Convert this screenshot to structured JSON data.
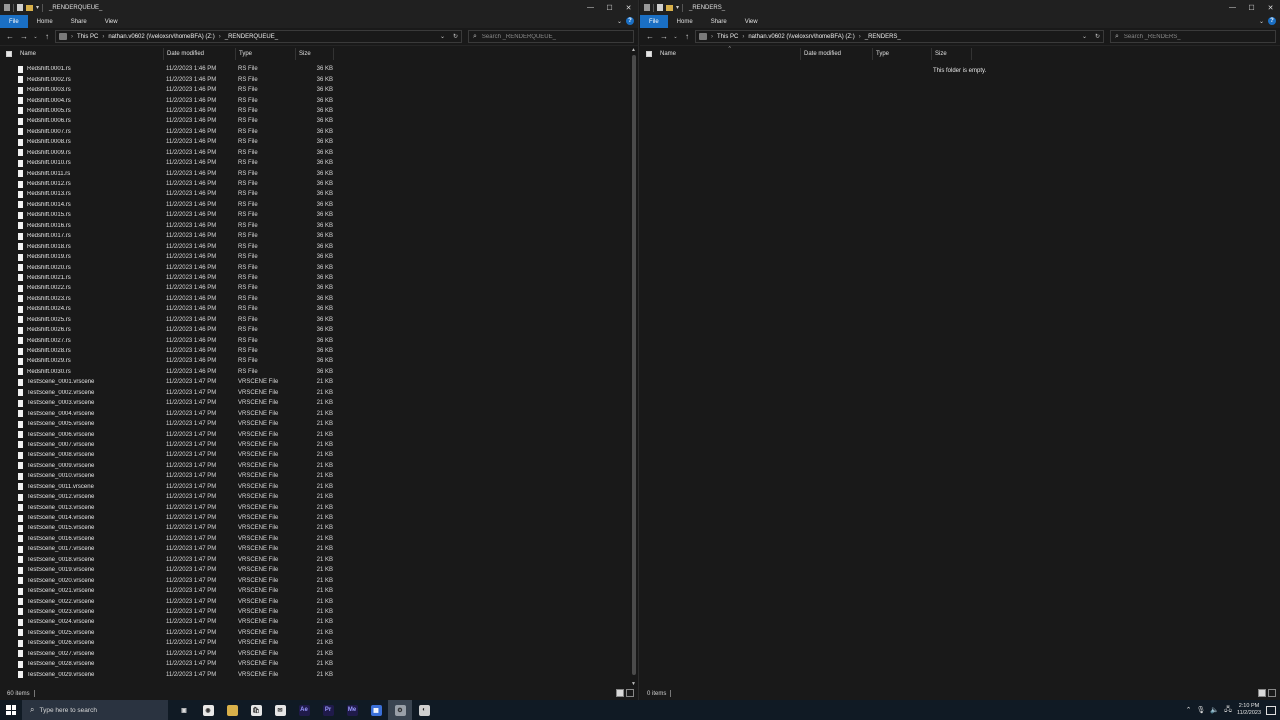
{
  "left": {
    "title": "_RENDERQUEUE_",
    "ribbon_tabs": [
      "File",
      "Home",
      "Share",
      "View"
    ],
    "breadcrumb": [
      "This PC",
      "nathan.v0602 (\\\\veloxsrv\\homeBFA) (Z:)",
      "_RENDERQUEUE_"
    ],
    "search_placeholder": "Search _RENDERQUEUE_",
    "columns": {
      "name": "Name",
      "date": "Date modified",
      "type": "Type",
      "size": "Size"
    },
    "files": [
      {
        "name": "Redshift.0001.rs",
        "date": "11/2/2023 1:46 PM",
        "type": "RS File",
        "size": "36 KB"
      },
      {
        "name": "Redshift.0002.rs",
        "date": "11/2/2023 1:46 PM",
        "type": "RS File",
        "size": "36 KB"
      },
      {
        "name": "Redshift.0003.rs",
        "date": "11/2/2023 1:46 PM",
        "type": "RS File",
        "size": "36 KB"
      },
      {
        "name": "Redshift.0004.rs",
        "date": "11/2/2023 1:46 PM",
        "type": "RS File",
        "size": "36 KB"
      },
      {
        "name": "Redshift.0005.rs",
        "date": "11/2/2023 1:46 PM",
        "type": "RS File",
        "size": "36 KB"
      },
      {
        "name": "Redshift.0006.rs",
        "date": "11/2/2023 1:46 PM",
        "type": "RS File",
        "size": "36 KB"
      },
      {
        "name": "Redshift.0007.rs",
        "date": "11/2/2023 1:46 PM",
        "type": "RS File",
        "size": "36 KB"
      },
      {
        "name": "Redshift.0008.rs",
        "date": "11/2/2023 1:46 PM",
        "type": "RS File",
        "size": "36 KB"
      },
      {
        "name": "Redshift.0009.rs",
        "date": "11/2/2023 1:46 PM",
        "type": "RS File",
        "size": "36 KB"
      },
      {
        "name": "Redshift.0010.rs",
        "date": "11/2/2023 1:46 PM",
        "type": "RS File",
        "size": "36 KB"
      },
      {
        "name": "Redshift.0011.rs",
        "date": "11/2/2023 1:46 PM",
        "type": "RS File",
        "size": "36 KB"
      },
      {
        "name": "Redshift.0012.rs",
        "date": "11/2/2023 1:46 PM",
        "type": "RS File",
        "size": "36 KB"
      },
      {
        "name": "Redshift.0013.rs",
        "date": "11/2/2023 1:46 PM",
        "type": "RS File",
        "size": "36 KB"
      },
      {
        "name": "Redshift.0014.rs",
        "date": "11/2/2023 1:46 PM",
        "type": "RS File",
        "size": "36 KB"
      },
      {
        "name": "Redshift.0015.rs",
        "date": "11/2/2023 1:46 PM",
        "type": "RS File",
        "size": "36 KB"
      },
      {
        "name": "Redshift.0016.rs",
        "date": "11/2/2023 1:46 PM",
        "type": "RS File",
        "size": "36 KB"
      },
      {
        "name": "Redshift.0017.rs",
        "date": "11/2/2023 1:46 PM",
        "type": "RS File",
        "size": "36 KB"
      },
      {
        "name": "Redshift.0018.rs",
        "date": "11/2/2023 1:46 PM",
        "type": "RS File",
        "size": "36 KB"
      },
      {
        "name": "Redshift.0019.rs",
        "date": "11/2/2023 1:46 PM",
        "type": "RS File",
        "size": "36 KB"
      },
      {
        "name": "Redshift.0020.rs",
        "date": "11/2/2023 1:46 PM",
        "type": "RS File",
        "size": "36 KB"
      },
      {
        "name": "Redshift.0021.rs",
        "date": "11/2/2023 1:46 PM",
        "type": "RS File",
        "size": "36 KB"
      },
      {
        "name": "Redshift.0022.rs",
        "date": "11/2/2023 1:46 PM",
        "type": "RS File",
        "size": "36 KB"
      },
      {
        "name": "Redshift.0023.rs",
        "date": "11/2/2023 1:46 PM",
        "type": "RS File",
        "size": "36 KB"
      },
      {
        "name": "Redshift.0024.rs",
        "date": "11/2/2023 1:46 PM",
        "type": "RS File",
        "size": "36 KB"
      },
      {
        "name": "Redshift.0025.rs",
        "date": "11/2/2023 1:46 PM",
        "type": "RS File",
        "size": "36 KB"
      },
      {
        "name": "Redshift.0026.rs",
        "date": "11/2/2023 1:46 PM",
        "type": "RS File",
        "size": "36 KB"
      },
      {
        "name": "Redshift.0027.rs",
        "date": "11/2/2023 1:46 PM",
        "type": "RS File",
        "size": "36 KB"
      },
      {
        "name": "Redshift.0028.rs",
        "date": "11/2/2023 1:46 PM",
        "type": "RS File",
        "size": "36 KB"
      },
      {
        "name": "Redshift.0029.rs",
        "date": "11/2/2023 1:46 PM",
        "type": "RS File",
        "size": "36 KB"
      },
      {
        "name": "Redshift.0030.rs",
        "date": "11/2/2023 1:46 PM",
        "type": "RS File",
        "size": "36 KB"
      },
      {
        "name": "TestScene_0001.vrscene",
        "date": "11/2/2023 1:47 PM",
        "type": "VRSCENE File",
        "size": "21 KB"
      },
      {
        "name": "TestScene_0002.vrscene",
        "date": "11/2/2023 1:47 PM",
        "type": "VRSCENE File",
        "size": "21 KB"
      },
      {
        "name": "TestScene_0003.vrscene",
        "date": "11/2/2023 1:47 PM",
        "type": "VRSCENE File",
        "size": "21 KB"
      },
      {
        "name": "TestScene_0004.vrscene",
        "date": "11/2/2023 1:47 PM",
        "type": "VRSCENE File",
        "size": "21 KB"
      },
      {
        "name": "TestScene_0005.vrscene",
        "date": "11/2/2023 1:47 PM",
        "type": "VRSCENE File",
        "size": "21 KB"
      },
      {
        "name": "TestScene_0006.vrscene",
        "date": "11/2/2023 1:47 PM",
        "type": "VRSCENE File",
        "size": "21 KB"
      },
      {
        "name": "TestScene_0007.vrscene",
        "date": "11/2/2023 1:47 PM",
        "type": "VRSCENE File",
        "size": "21 KB"
      },
      {
        "name": "TestScene_0008.vrscene",
        "date": "11/2/2023 1:47 PM",
        "type": "VRSCENE File",
        "size": "21 KB"
      },
      {
        "name": "TestScene_0009.vrscene",
        "date": "11/2/2023 1:47 PM",
        "type": "VRSCENE File",
        "size": "21 KB"
      },
      {
        "name": "TestScene_0010.vrscene",
        "date": "11/2/2023 1:47 PM",
        "type": "VRSCENE File",
        "size": "21 KB"
      },
      {
        "name": "TestScene_0011.vrscene",
        "date": "11/2/2023 1:47 PM",
        "type": "VRSCENE File",
        "size": "21 KB"
      },
      {
        "name": "TestScene_0012.vrscene",
        "date": "11/2/2023 1:47 PM",
        "type": "VRSCENE File",
        "size": "21 KB"
      },
      {
        "name": "TestScene_0013.vrscene",
        "date": "11/2/2023 1:47 PM",
        "type": "VRSCENE File",
        "size": "21 KB"
      },
      {
        "name": "TestScene_0014.vrscene",
        "date": "11/2/2023 1:47 PM",
        "type": "VRSCENE File",
        "size": "21 KB"
      },
      {
        "name": "TestScene_0015.vrscene",
        "date": "11/2/2023 1:47 PM",
        "type": "VRSCENE File",
        "size": "21 KB"
      },
      {
        "name": "TestScene_0016.vrscene",
        "date": "11/2/2023 1:47 PM",
        "type": "VRSCENE File",
        "size": "21 KB"
      },
      {
        "name": "TestScene_0017.vrscene",
        "date": "11/2/2023 1:47 PM",
        "type": "VRSCENE File",
        "size": "21 KB"
      },
      {
        "name": "TestScene_0018.vrscene",
        "date": "11/2/2023 1:47 PM",
        "type": "VRSCENE File",
        "size": "21 KB"
      },
      {
        "name": "TestScene_0019.vrscene",
        "date": "11/2/2023 1:47 PM",
        "type": "VRSCENE File",
        "size": "21 KB"
      },
      {
        "name": "TestScene_0020.vrscene",
        "date": "11/2/2023 1:47 PM",
        "type": "VRSCENE File",
        "size": "21 KB"
      },
      {
        "name": "TestScene_0021.vrscene",
        "date": "11/2/2023 1:47 PM",
        "type": "VRSCENE File",
        "size": "21 KB"
      },
      {
        "name": "TestScene_0022.vrscene",
        "date": "11/2/2023 1:47 PM",
        "type": "VRSCENE File",
        "size": "21 KB"
      },
      {
        "name": "TestScene_0023.vrscene",
        "date": "11/2/2023 1:47 PM",
        "type": "VRSCENE File",
        "size": "21 KB"
      },
      {
        "name": "TestScene_0024.vrscene",
        "date": "11/2/2023 1:47 PM",
        "type": "VRSCENE File",
        "size": "21 KB"
      },
      {
        "name": "TestScene_0025.vrscene",
        "date": "11/2/2023 1:47 PM",
        "type": "VRSCENE File",
        "size": "21 KB"
      },
      {
        "name": "TestScene_0026.vrscene",
        "date": "11/2/2023 1:47 PM",
        "type": "VRSCENE File",
        "size": "21 KB"
      },
      {
        "name": "TestScene_0027.vrscene",
        "date": "11/2/2023 1:47 PM",
        "type": "VRSCENE File",
        "size": "21 KB"
      },
      {
        "name": "TestScene_0028.vrscene",
        "date": "11/2/2023 1:47 PM",
        "type": "VRSCENE File",
        "size": "21 KB"
      },
      {
        "name": "TestScene_0029.vrscene",
        "date": "11/2/2023 1:47 PM",
        "type": "VRSCENE File",
        "size": "21 KB"
      }
    ],
    "status": "60 items"
  },
  "right": {
    "title": "_RENDERS_",
    "ribbon_tabs": [
      "File",
      "Home",
      "Share",
      "View"
    ],
    "breadcrumb": [
      "This PC",
      "nathan.v0602 (\\\\veloxsrv\\homeBFA) (Z:)",
      "_RENDERS_"
    ],
    "search_placeholder": "Search _RENDERS_",
    "columns": {
      "name": "Name",
      "date": "Date modified",
      "type": "Type",
      "size": "Size"
    },
    "empty_message": "This folder is empty.",
    "status": "0 items"
  },
  "taskbar": {
    "search_text": "Type here to search",
    "apps": [
      {
        "icon": "task-view-icon",
        "label": ""
      },
      {
        "icon": "chrome-icon",
        "label": ""
      },
      {
        "icon": "file-explorer-icon",
        "label": ""
      },
      {
        "icon": "store-icon",
        "label": ""
      },
      {
        "icon": "mail-icon",
        "label": ""
      },
      {
        "icon": "after-effects-icon",
        "label": "Ae"
      },
      {
        "icon": "premiere-icon",
        "label": "Pr"
      },
      {
        "icon": "media-encoder-icon",
        "label": "Me"
      },
      {
        "icon": "app-icon",
        "label": ""
      },
      {
        "icon": "app-active-icon",
        "label": ""
      },
      {
        "icon": "steam-icon",
        "label": ""
      }
    ],
    "clock_time": "2:10 PM",
    "clock_date": "11/2/2023"
  }
}
